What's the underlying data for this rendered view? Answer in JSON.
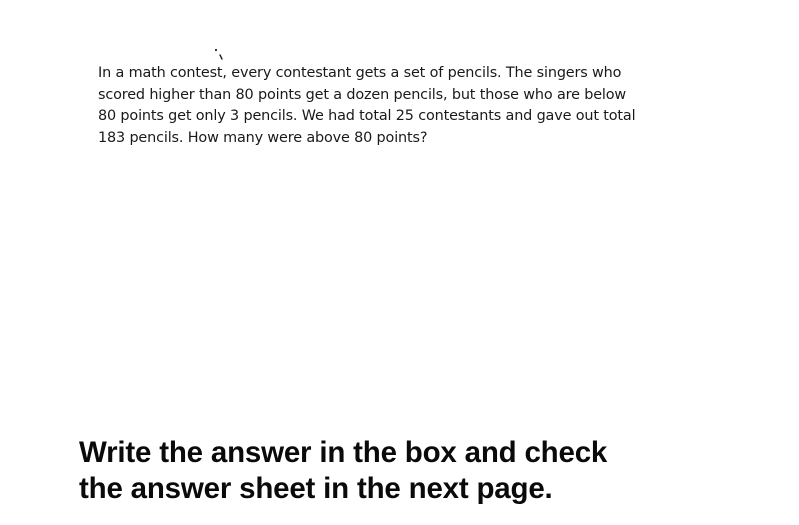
{
  "question": {
    "text": "In a math contest, every contestant gets a set of pencils. The singers who scored higher than 80 points get a dozen pencils, but those who are below 80 points get only 3 pencils. We had total 25 contestants and gave out total 183 pencils. How many were above 80 points?"
  },
  "instruction": {
    "line1": "Write the answer in the box and check",
    "line2": "the answer sheet in the next page."
  }
}
